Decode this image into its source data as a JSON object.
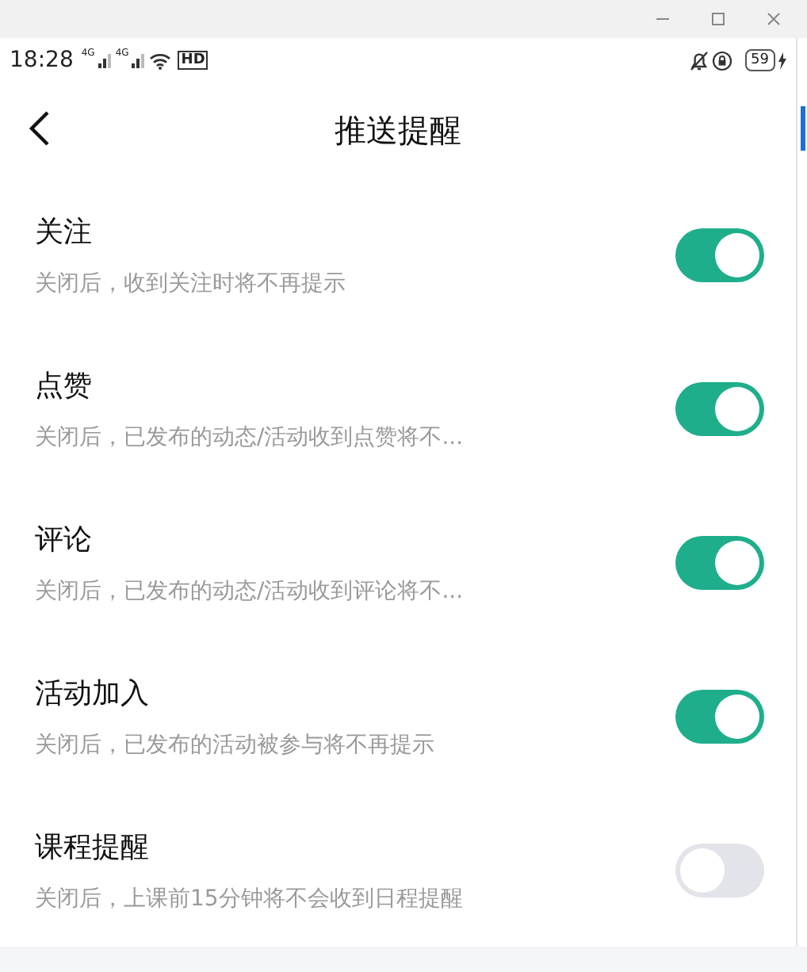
{
  "status_bar": {
    "time": "18:28",
    "network_labels": [
      "4G",
      "4G"
    ],
    "hd_label": "HD",
    "battery": "59"
  },
  "header": {
    "title": "推送提醒"
  },
  "settings": [
    {
      "title": "关注",
      "description": "关闭后，收到关注时将不再提示",
      "on": true
    },
    {
      "title": "点赞",
      "description": "关闭后，已发布的动态/活动收到点赞将不...",
      "on": true
    },
    {
      "title": "评论",
      "description": "关闭后，已发布的动态/活动收到评论将不...",
      "on": true
    },
    {
      "title": "活动加入",
      "description": "关闭后，已发布的活动被参与将不再提示",
      "on": true
    },
    {
      "title": "课程提醒",
      "description": "关闭后，上课前15分钟将不会收到日程提醒",
      "on": false
    }
  ]
}
